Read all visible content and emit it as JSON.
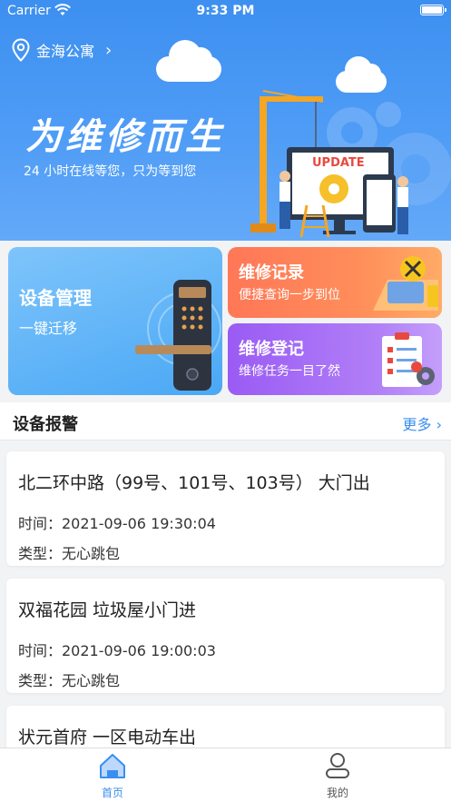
{
  "status_bar": {
    "carrier": "Carrier",
    "time": "9:33 PM"
  },
  "location": {
    "name": "金海公寓",
    "icon": "location-pin-icon"
  },
  "banner": {
    "slogan": "为维修而生",
    "subtitle": "24 小时在线等您，只为等到您",
    "update_text": "UPDATE"
  },
  "features": {
    "device": {
      "title": "设备管理",
      "subtitle": "一键迁移"
    },
    "repair_record": {
      "title": "维修记录",
      "subtitle": "便捷查询一步到位"
    },
    "repair_register": {
      "title": "维修登记",
      "subtitle": "维修任务一目了然"
    }
  },
  "alarms": {
    "title": "设备报警",
    "more": "更多",
    "items": [
      {
        "title": "北二环中路（99号、101号、103号） 大门出",
        "time": "时间：2021-09-06 19:30:04",
        "type": "类型：无心跳包"
      },
      {
        "title": "双福花园 垃圾屋小门进",
        "time": "时间：2021-09-06 19:00:03",
        "type": "类型：无心跳包"
      },
      {
        "title": "状元首府 一区电动车出",
        "time": "",
        "type": ""
      }
    ]
  },
  "tabs": [
    {
      "label": "首页",
      "icon": "home-icon",
      "active": true
    },
    {
      "label": "我的",
      "icon": "user-icon",
      "active": false
    }
  ],
  "colors": {
    "accent": "#3a8ef0",
    "repair": "#ff7757",
    "register": "#a066f5"
  }
}
